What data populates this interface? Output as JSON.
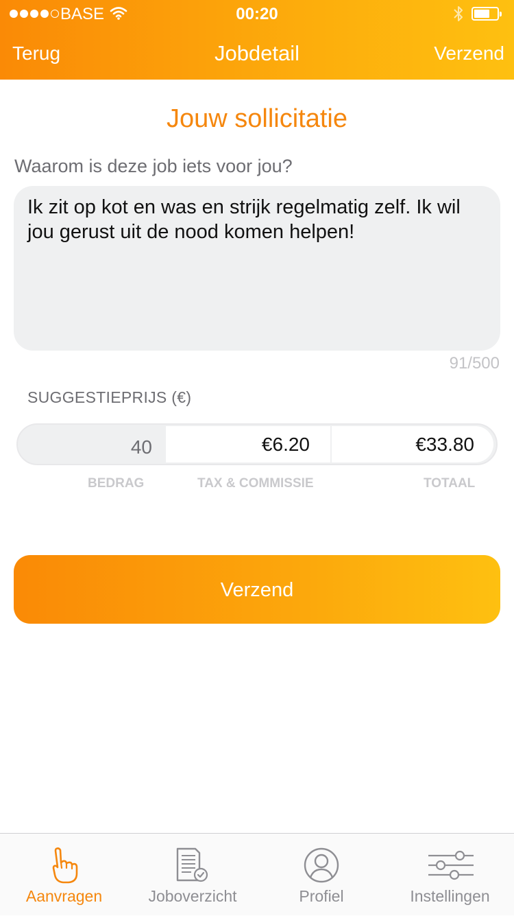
{
  "status_bar": {
    "carrier": "BASE",
    "time": "00:20"
  },
  "nav": {
    "back_label": "Terug",
    "title": "Jobdetail",
    "send_label": "Verzend"
  },
  "form": {
    "title": "Jouw sollicitatie",
    "question": "Waarom is deze job iets voor jou?",
    "motivation": "Ik zit op kot en was en strijk regelmatig zelf. Ik wil jou gerust uit de nood komen helpen!",
    "counter": "91/500",
    "price_label": "SUGGESTIEPRIJS (€)",
    "amount": "40",
    "tax": "€6.20",
    "total": "€33.80",
    "col_labels": {
      "amount": "BEDRAG",
      "tax": "TAX & COMMISSIE",
      "total": "TOTAAL"
    },
    "submit_label": "Verzend"
  },
  "tabs": [
    {
      "label": "Aanvragen",
      "icon": "hand-pointing-icon",
      "active": true
    },
    {
      "label": "Joboverzicht",
      "icon": "document-check-icon",
      "active": false
    },
    {
      "label": "Profiel",
      "icon": "user-circle-icon",
      "active": false
    },
    {
      "label": "Instellingen",
      "icon": "sliders-icon",
      "active": false
    }
  ],
  "colors": {
    "accent": "#f5870e",
    "gradient_start": "#fa8a06",
    "gradient_end": "#fec010"
  }
}
